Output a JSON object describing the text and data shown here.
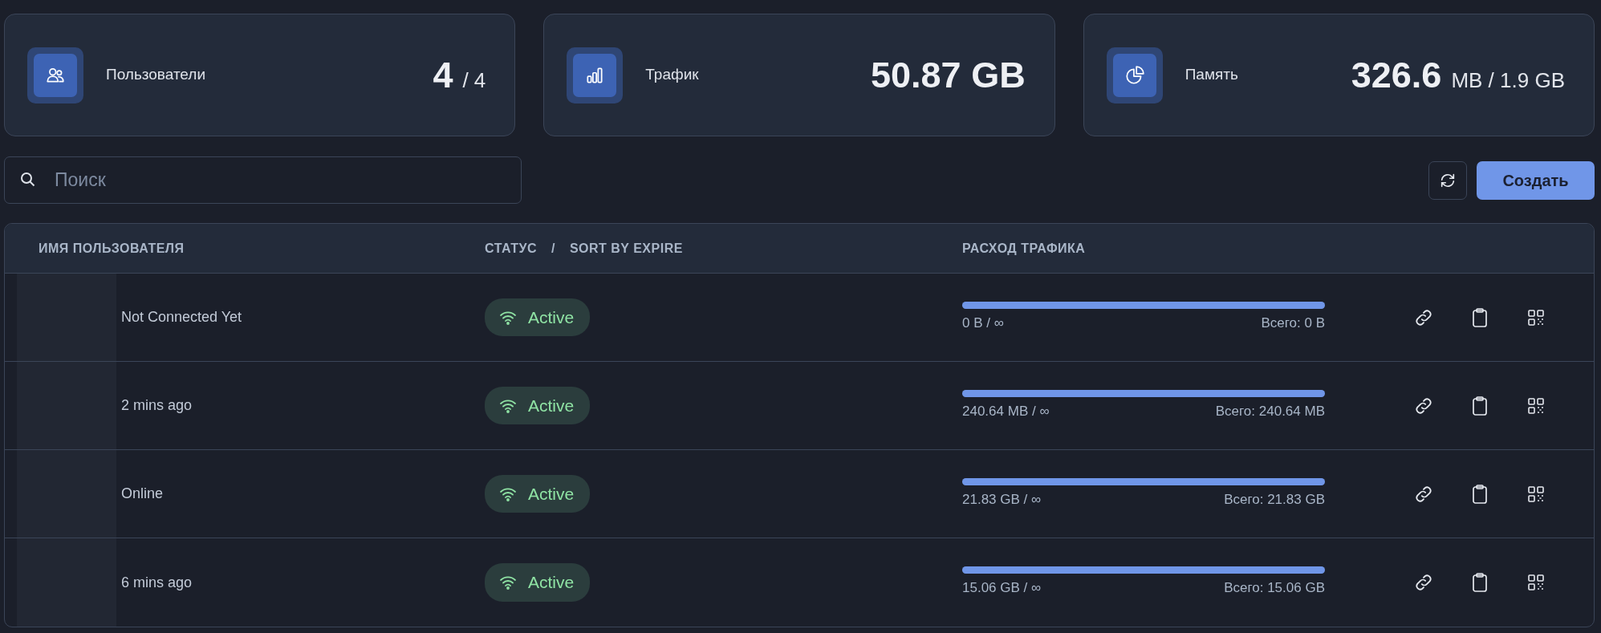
{
  "stats": [
    {
      "kind": "users",
      "label": "Пользователи",
      "value": "4",
      "unit": "/ 4"
    },
    {
      "kind": "traffic",
      "label": "Трафик",
      "value": "50.87 GB"
    },
    {
      "kind": "memory",
      "label": "Память",
      "value": "326.6",
      "unit": "MB / 1.9 GB"
    }
  ],
  "search": {
    "placeholder": "Поиск"
  },
  "create_button": "Создать",
  "table": {
    "columns": [
      {
        "kind": "name",
        "label": "ИМЯ ПОЛЬЗОВАТЕЛЯ"
      },
      {
        "kind": "status",
        "label": "СТАТУС",
        "separator": "/",
        "sort_label": "SORT BY EXPIRE"
      },
      {
        "kind": "traffic",
        "label": "РАСХОД ТРАФИКА"
      }
    ],
    "rows": [
      {
        "last_seen": "Not Connected Yet",
        "status": "Active",
        "used": "0 B / ∞",
        "total": "Всего: 0 B",
        "level": 1
      },
      {
        "last_seen": "2 mins ago",
        "status": "Active",
        "used": "240.64 MB / ∞",
        "total": "Всего: 240.64 MB",
        "level": 1
      },
      {
        "last_seen": "Online",
        "status": "Active",
        "used": "21.83 GB / ∞",
        "total": "Всего: 21.83 GB",
        "level": 1
      },
      {
        "last_seen": "6 mins ago",
        "status": "Active",
        "used": "15.06 GB / ∞",
        "total": "Всего: 15.06 GB",
        "level": 1
      }
    ]
  }
}
